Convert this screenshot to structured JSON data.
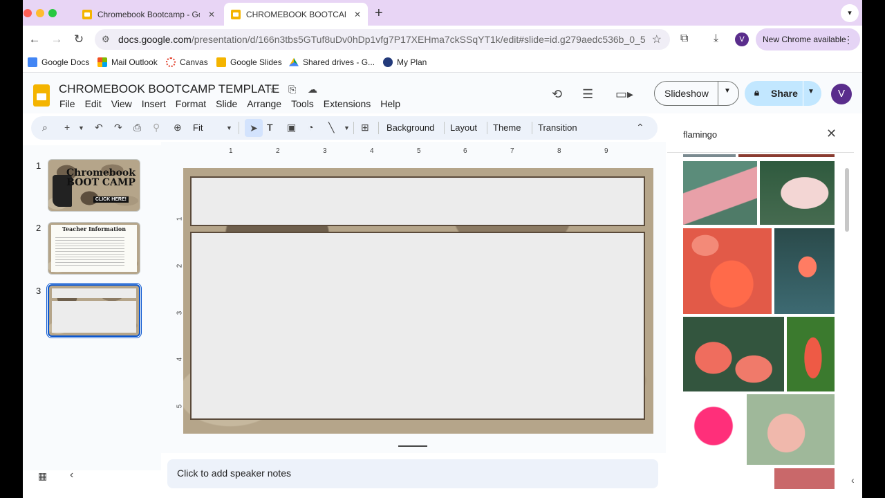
{
  "browser": {
    "tabs": [
      {
        "title": "Chromebook Bootcamp - Go"
      },
      {
        "title": "CHROMEBOOK BOOTCAMP"
      }
    ],
    "url_domain": "docs.google.com",
    "url_path": "/presentation/d/166n3tbs5GTuf8uDv0hDp1vfg7P17XEHma7ckSSqYT1k/edit#slide=id.g279aedc536b_0_5",
    "profile_initial": "V",
    "new_chrome_label": "New Chrome available",
    "bookmarks": [
      {
        "label": "Google Docs",
        "color": "#4285f4"
      },
      {
        "label": "Mail Outlook",
        "color": "#f25022"
      },
      {
        "label": "Canvas",
        "color": "#e13f2b"
      },
      {
        "label": "Google Slides",
        "color": "#f4b400"
      },
      {
        "label": "Shared drives - G...",
        "color": "#0f9d58"
      },
      {
        "label": "My Plan",
        "color": "#233a7a"
      }
    ]
  },
  "app": {
    "title": "CHROMEBOOK BOOTCAMP TEMPLATE",
    "menu": [
      "File",
      "Edit",
      "View",
      "Insert",
      "Format",
      "Slide",
      "Arrange",
      "Tools",
      "Extensions",
      "Help"
    ],
    "slideshow_label": "Slideshow",
    "share_label": "Share",
    "avatar_initial": "V"
  },
  "toolbar": {
    "zoom": "Fit",
    "background": "Background",
    "layout": "Layout",
    "theme": "Theme",
    "transition": "Transition"
  },
  "filmstrip": {
    "slides": [
      {
        "number": "1",
        "title_line1": "Chromebook",
        "title_line2": "BOOT CAMP",
        "button": "CLICK HERE!"
      },
      {
        "number": "2",
        "title": "Teacher Information"
      },
      {
        "number": "3"
      }
    ]
  },
  "rulers": {
    "horizontal": [
      "1",
      "2",
      "3",
      "4",
      "5",
      "6",
      "7",
      "8",
      "9"
    ],
    "vertical": [
      "1",
      "2",
      "3",
      "4",
      "5"
    ]
  },
  "notes": {
    "placeholder": "Click to add speaker notes"
  },
  "image_search": {
    "query": "flamingo"
  },
  "colors": {
    "accent": "#0b57d0",
    "share_bg": "#c2e7ff",
    "tabstrip": "#e8d5f5",
    "camo_dark": "#5a4a3a"
  }
}
